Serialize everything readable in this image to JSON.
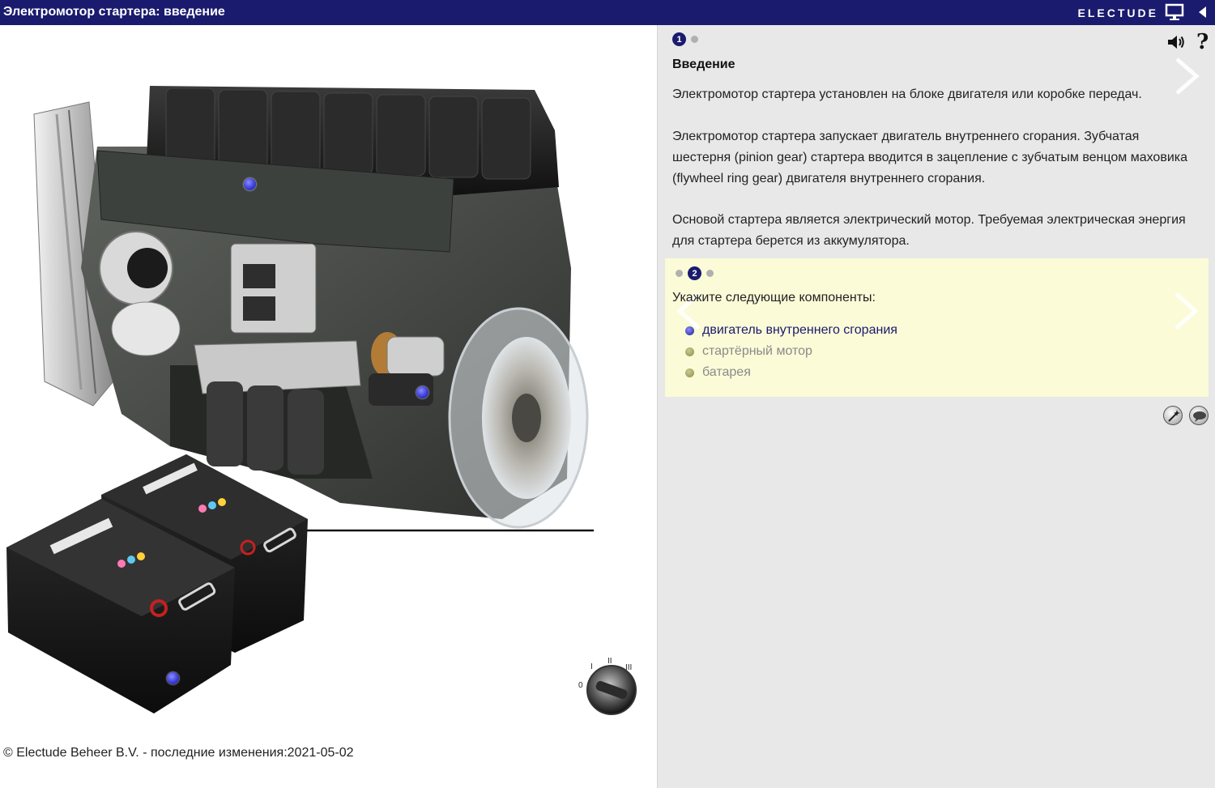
{
  "header": {
    "title": "Электромотор стартера: введение",
    "brand": "ELECTUDE"
  },
  "icons": {
    "screen": "presentation-screen-icon",
    "collapse": "triangle-left-icon",
    "speaker": "speaker-icon",
    "help": "question-mark-icon",
    "next": "chevron-right-icon",
    "ignition": "ignition-switch-icon",
    "tool1": "magic-wand-icon",
    "tool2": "speech-bubble-icon"
  },
  "footer": {
    "copyright": "© Electude Beheer B.V. - последние изменения:2021-05-02"
  },
  "ignition": {
    "labels": [
      "0",
      "I",
      "II",
      "III"
    ]
  },
  "panel": {
    "step_indicator": {
      "active_label": "1"
    },
    "title": "Введение",
    "help_text": "?",
    "paragraphs": [
      "Электромотор стартера установлен на блоке двигателя или коробке передач.",
      "Электромотор стартера запускает двигатель внутреннего сгорания. Зубчатая шестерня (pinion gear) стартера вводится в зацепление с зубчатым венцом маховика (flywheel ring gear) двигателя внутреннего сгорания.",
      "Основой стартера является электрический мотор. Требуемая электрическая энергия для стартера берется из аккумулятора."
    ]
  },
  "task": {
    "step_indicator": {
      "active_label": "2"
    },
    "title": "Укажите следующие компоненты:",
    "items": [
      {
        "label": "двигатель внутреннего сгорания",
        "state": "current"
      },
      {
        "label": "стартёрный мотор",
        "state": "pending"
      },
      {
        "label": "батарея",
        "state": "pending"
      }
    ]
  },
  "colors": {
    "header_bg": "#1a1a6e",
    "hotspot": "#3b3ed8",
    "task_bg": "#fbfbd8",
    "panel_bg": "#e8e8e8"
  }
}
